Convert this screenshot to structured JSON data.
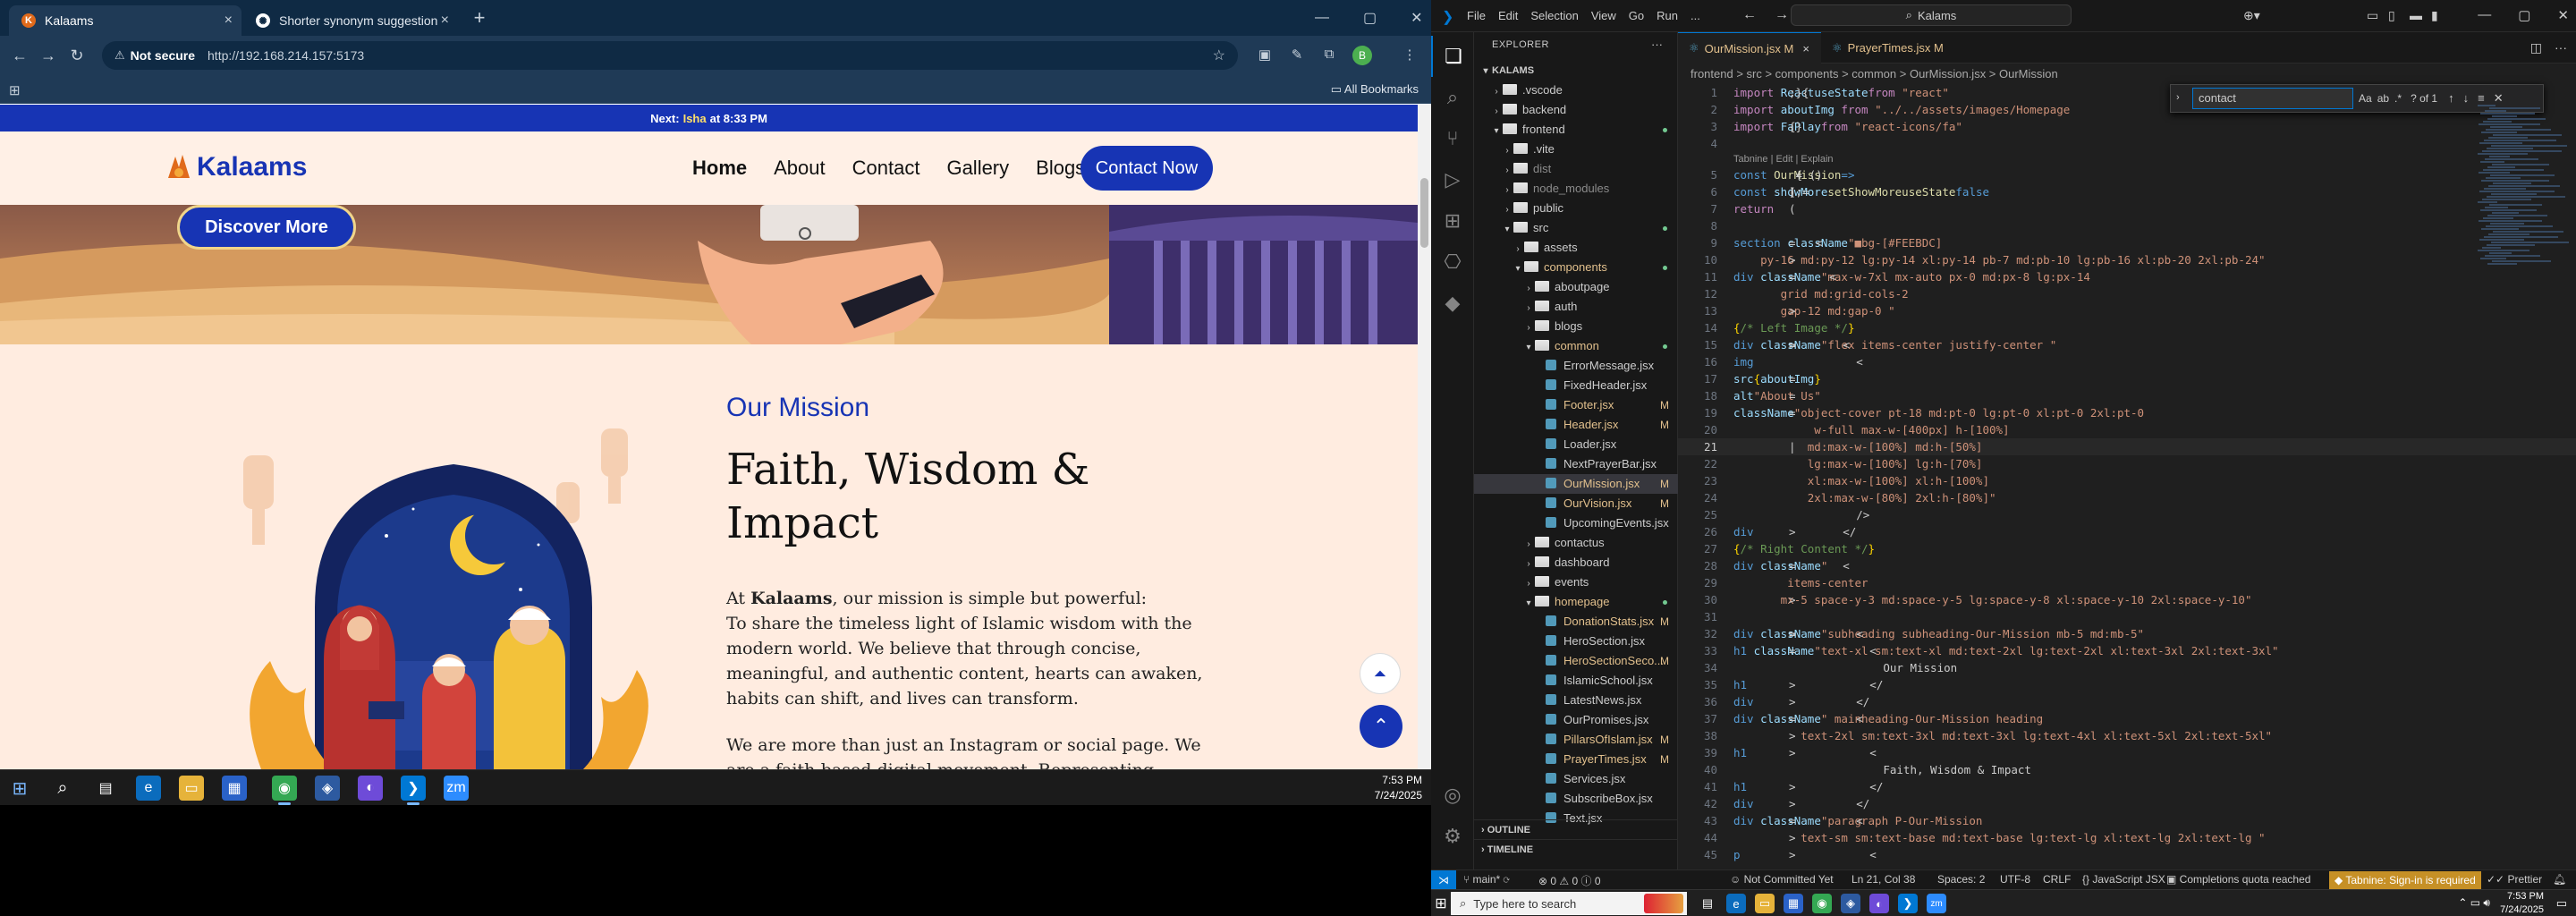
{
  "browser": {
    "tabs": [
      {
        "title": "Kalaams",
        "active": true
      },
      {
        "title": "Shorter synonym suggestion",
        "active": false
      }
    ],
    "security_label": "Not secure",
    "url": "http://192.168.214.157:5173",
    "all_bookmarks": "All Bookmarks",
    "profile_initial": "B"
  },
  "site": {
    "top_strip_prefix": "Next:",
    "top_strip_name": "Isha",
    "top_strip_suffix": "at 8:33 PM",
    "logo_text": "Kalaams",
    "nav": [
      "Home",
      "About",
      "Contact",
      "Gallery",
      "Blogs"
    ],
    "cta": "Contact Now",
    "discover": "Discover More",
    "mission": {
      "subheading": "Our Mission",
      "title": "Faith, Wisdom & Impact",
      "para1_prefix": "At",
      "para1_brand": "Kalaams",
      "para1_rest": ", our mission is simple but powerful:",
      "para1_body": "To share the timeless light of Islamic wisdom with the modern world. We believe that through concise, meaningful, and authentic content, hearts can awaken, habits can shift, and lives can transform.",
      "para2": "We are more than just an Instagram or social page. We are a faith-based digital movement. Representing Kalaams official"
    }
  },
  "taskbar1": {
    "time": "7:53 PM",
    "date": "7/24/2025"
  },
  "vscode": {
    "menu": [
      "File",
      "Edit",
      "Selection",
      "View",
      "Go",
      "Run",
      "..."
    ],
    "search": "Kalams",
    "explorer_label": "EXPLORER",
    "root": "KALAMS",
    "tree": [
      {
        "name": ".vscode",
        "depth": 1,
        "type": "folder",
        "open": false
      },
      {
        "name": "backend",
        "depth": 1,
        "type": "folder",
        "open": false
      },
      {
        "name": "frontend",
        "depth": 1,
        "type": "folder",
        "open": true,
        "mod": "dot"
      },
      {
        "name": ".vite",
        "depth": 2,
        "type": "folder",
        "open": false
      },
      {
        "name": "dist",
        "depth": 2,
        "type": "folder",
        "open": false,
        "dim": true
      },
      {
        "name": "node_modules",
        "depth": 2,
        "type": "folder",
        "open": false,
        "dim": true
      },
      {
        "name": "public",
        "depth": 2,
        "type": "folder",
        "open": false
      },
      {
        "name": "src",
        "depth": 2,
        "type": "folder",
        "open": true,
        "mod": "dot"
      },
      {
        "name": "assets",
        "depth": 3,
        "type": "folder",
        "open": false
      },
      {
        "name": "components",
        "depth": 3,
        "type": "folder",
        "open": true,
        "mod": "dot",
        "modc": true
      },
      {
        "name": "aboutpage",
        "depth": 4,
        "type": "folder",
        "open": false
      },
      {
        "name": "auth",
        "depth": 4,
        "type": "folder",
        "open": false
      },
      {
        "name": "blogs",
        "depth": 4,
        "type": "folder",
        "open": false
      },
      {
        "name": "common",
        "depth": 4,
        "type": "folder",
        "open": true,
        "mod": "dot",
        "modc": true
      },
      {
        "name": "ErrorMessage.jsx",
        "depth": 5,
        "type": "file"
      },
      {
        "name": "FixedHeader.jsx",
        "depth": 5,
        "type": "file"
      },
      {
        "name": "Footer.jsx",
        "depth": 5,
        "type": "file",
        "mod": "M"
      },
      {
        "name": "Header.jsx",
        "depth": 5,
        "type": "file",
        "mod": "M"
      },
      {
        "name": "Loader.jsx",
        "depth": 5,
        "type": "file"
      },
      {
        "name": "NextPrayerBar.jsx",
        "depth": 5,
        "type": "file"
      },
      {
        "name": "OurMission.jsx",
        "depth": 5,
        "type": "file",
        "mod": "M",
        "sel": true
      },
      {
        "name": "OurVision.jsx",
        "depth": 5,
        "type": "file",
        "mod": "M"
      },
      {
        "name": "UpcomingEvents.jsx",
        "depth": 5,
        "type": "file"
      },
      {
        "name": "contactus",
        "depth": 4,
        "type": "folder",
        "open": false
      },
      {
        "name": "dashboard",
        "depth": 4,
        "type": "folder",
        "open": false
      },
      {
        "name": "events",
        "depth": 4,
        "type": "folder",
        "open": false
      },
      {
        "name": "homepage",
        "depth": 4,
        "type": "folder",
        "open": true,
        "mod": "dot",
        "modc": true
      },
      {
        "name": "DonationStats.jsx",
        "depth": 5,
        "type": "file",
        "mod": "M"
      },
      {
        "name": "HeroSection.jsx",
        "depth": 5,
        "type": "file"
      },
      {
        "name": "HeroSectionSeco...",
        "depth": 5,
        "type": "file",
        "mod": "M"
      },
      {
        "name": "IslamicSchool.jsx",
        "depth": 5,
        "type": "file"
      },
      {
        "name": "LatestNews.jsx",
        "depth": 5,
        "type": "file"
      },
      {
        "name": "OurPromises.jsx",
        "depth": 5,
        "type": "file"
      },
      {
        "name": "PillarsOfIslam.jsx",
        "depth": 5,
        "type": "file",
        "mod": "M"
      },
      {
        "name": "PrayerTimes.jsx",
        "depth": 5,
        "type": "file",
        "mod": "M"
      },
      {
        "name": "Services.jsx",
        "depth": 5,
        "type": "file"
      },
      {
        "name": "SubscribeBox.jsx",
        "depth": 5,
        "type": "file"
      },
      {
        "name": "Text.jsx",
        "depth": 5,
        "type": "file"
      }
    ],
    "outline": "OUTLINE",
    "timeline": "TIMELINE",
    "editor_tabs": [
      {
        "name": "OurMission.jsx",
        "mod": "M",
        "active": true
      },
      {
        "name": "PrayerTimes.jsx",
        "mod": "M",
        "active": false
      }
    ],
    "breadcrumb": "frontend > src > components > common > OurMission.jsx > OurMission",
    "find": {
      "query": "contact",
      "result": "? of 1"
    },
    "lens": "Tabnine | Edit | Explain",
    "status": {
      "branch": "main*",
      "errors": "0",
      "warnings": "0",
      "problems_extra": "0",
      "commit": "Not Committed Yet",
      "position": "Ln 21, Col 38",
      "spaces": "Spaces: 2",
      "encoding": "UTF-8",
      "eol": "CRLF",
      "language": "JavaScript JSX",
      "quota": "Completions quota reached",
      "tabnine": "Tabnine: Sign-in is required",
      "prettier": "Prettier"
    }
  },
  "code": [
    [
      [
        "kw",
        "import "
      ],
      [
        "vr",
        "React"
      ],
      [
        "tx",
        ", { "
      ],
      [
        "vr",
        "useState"
      ],
      [
        "tx",
        " } "
      ],
      [
        "kw",
        "from "
      ],
      [
        "st",
        "\"react\""
      ],
      [
        "tx",
        ";"
      ]
    ],
    [
      [
        "kw",
        "import "
      ],
      [
        "vr",
        "aboutImg"
      ],
      [
        "kw",
        " from "
      ],
      [
        "st",
        "\"../../assets/images/Homepage"
      ]
    ],
    [
      [
        "kw",
        "import "
      ],
      [
        "tx",
        "{ "
      ],
      [
        "vr",
        "FaPlay"
      ],
      [
        "tx",
        " } "
      ],
      [
        "kw",
        "from "
      ],
      [
        "st",
        "\"react-icons/fa\""
      ],
      [
        "tx",
        ";"
      ]
    ],
    [],
    [
      [
        "kb",
        "const "
      ],
      [
        "fn",
        "OurMission"
      ],
      [
        "tx",
        " = () "
      ],
      [
        "kb",
        "=>"
      ],
      [
        "tx",
        " {"
      ]
    ],
    [
      [
        "tx",
        "  "
      ],
      [
        "kb",
        "const "
      ],
      [
        "tx",
        "["
      ],
      [
        "vr",
        "showMore"
      ],
      [
        "tx",
        ", "
      ],
      [
        "fn",
        "setShowMore"
      ],
      [
        "tx",
        "] = "
      ],
      [
        "fn",
        "useState"
      ],
      [
        "tx",
        "("
      ],
      [
        "kb",
        "false"
      ],
      [
        "tx",
        ");"
      ]
    ],
    [
      [
        "tx",
        "  "
      ],
      [
        "kw",
        "return "
      ],
      [
        "tx",
        "("
      ]
    ],
    [],
    [
      [
        "tx",
        "    <"
      ],
      [
        "tg",
        "section "
      ],
      [
        "at",
        "className"
      ],
      [
        "tx",
        "="
      ],
      [
        "st",
        "\"■bg-[#FEEBDC]"
      ]
    ],
    [
      [
        "st",
        "    py-16 md:py-12 lg:py-14 xl:py-14 pb-7 md:pb-10 lg:pb-16 xl:pb-20 2xl:pb-24\""
      ],
      [
        "tx",
        ">"
      ]
    ],
    [
      [
        "tx",
        "      <"
      ],
      [
        "tg",
        "div "
      ],
      [
        "at",
        "className"
      ],
      [
        "tx",
        "="
      ],
      [
        "st",
        "\"max-w-7xl mx-auto px-0 md:px-8 lg:px-14"
      ]
    ],
    [
      [
        "st",
        "       grid md:grid-cols-2"
      ]
    ],
    [
      [
        "st",
        "       gap-12 md:gap-0 \""
      ],
      [
        "tx",
        ">"
      ]
    ],
    [
      [
        "tx",
        "        "
      ],
      [
        "pu",
        "{"
      ],
      [
        "cm",
        "/* Left Image */"
      ],
      [
        "pu",
        "}"
      ]
    ],
    [
      [
        "tx",
        "        <"
      ],
      [
        "tg",
        "div "
      ],
      [
        "at",
        "className"
      ],
      [
        "tx",
        "="
      ],
      [
        "st",
        "\"flex items-center justify-center \""
      ],
      [
        "tx",
        ">"
      ]
    ],
    [
      [
        "tx",
        "          <"
      ],
      [
        "tg",
        "img"
      ]
    ],
    [
      [
        "tx",
        "            "
      ],
      [
        "at",
        "src"
      ],
      [
        "tx",
        "="
      ],
      [
        "pu",
        "{"
      ],
      [
        "vr",
        "aboutImg"
      ],
      [
        "pu",
        "}"
      ]
    ],
    [
      [
        "tx",
        "            "
      ],
      [
        "at",
        "alt"
      ],
      [
        "tx",
        "="
      ],
      [
        "st",
        "\"About Us\""
      ]
    ],
    [
      [
        "tx",
        "            "
      ],
      [
        "at",
        "className"
      ],
      [
        "tx",
        "="
      ],
      [
        "st",
        "\"object-cover pt-18 md:pt-0 lg:pt-0 xl:pt-0 2xl:pt-0"
      ]
    ],
    [
      [
        "st",
        "            w-full max-w-[400px] h-[100%]"
      ]
    ],
    [
      [
        "st",
        "           md:max-w-[100%] md:h-[50%]"
      ],
      [
        "tx",
        "|"
      ]
    ],
    [
      [
        "st",
        "           lg:max-w-[100%] lg:h-[70%]"
      ]
    ],
    [
      [
        "st",
        "           xl:max-w-[100%] xl:h-[100%]"
      ]
    ],
    [
      [
        "st",
        "           2xl:max-w-[80%] 2xl:h-[80%]\""
      ]
    ],
    [
      [
        "tx",
        "          />"
      ]
    ],
    [
      [
        "tx",
        "        </"
      ],
      [
        "tg",
        "div"
      ],
      [
        "tx",
        ">"
      ]
    ],
    [
      [
        "tx",
        "        "
      ],
      [
        "pu",
        "{"
      ],
      [
        "cm",
        "/* Right Content */"
      ],
      [
        "pu",
        "}"
      ]
    ],
    [
      [
        "tx",
        "        <"
      ],
      [
        "tg",
        "div "
      ],
      [
        "at",
        "className"
      ],
      [
        "tx",
        "="
      ],
      [
        "st",
        "\""
      ]
    ],
    [
      [
        "st",
        "        items-center"
      ]
    ],
    [
      [
        "st",
        "       mx-5 space-y-3 md:space-y-5 lg:space-y-8 xl:space-y-10 2xl:space-y-10\""
      ],
      [
        "tx",
        ">"
      ]
    ],
    [],
    [
      [
        "tx",
        "          <"
      ],
      [
        "tg",
        "div "
      ],
      [
        "at",
        "className"
      ],
      [
        "tx",
        "="
      ],
      [
        "st",
        "\"subheading subheading-Our-Mission mb-5 md:mb-5\""
      ],
      [
        "tx",
        ">"
      ]
    ],
    [
      [
        "tx",
        "            <"
      ],
      [
        "tg",
        "h1 "
      ],
      [
        "at",
        "className"
      ],
      [
        "tx",
        "="
      ],
      [
        "st",
        "\"text-xl sm:text-xl md:text-2xl lg:text-2xl xl:text-3xl 2xl:text-3xl\""
      ]
    ],
    [
      [
        "tx",
        "              Our Mission"
      ]
    ],
    [
      [
        "tx",
        "            </"
      ],
      [
        "tg",
        "h1"
      ],
      [
        "tx",
        ">"
      ]
    ],
    [
      [
        "tx",
        "          </"
      ],
      [
        "tg",
        "div"
      ],
      [
        "tx",
        ">"
      ]
    ],
    [
      [
        "tx",
        "          <"
      ],
      [
        "tg",
        "div "
      ],
      [
        "at",
        "className"
      ],
      [
        "tx",
        "="
      ],
      [
        "st",
        "\" mainheading-Our-Mission heading"
      ]
    ],
    [
      [
        "st",
        "          text-2xl sm:text-3xl md:text-3xl lg:text-4xl xl:text-5xl 2xl:text-5xl\""
      ],
      [
        "tx",
        ">"
      ]
    ],
    [
      [
        "tx",
        "            <"
      ],
      [
        "tg",
        "h1"
      ],
      [
        "tx",
        ">"
      ]
    ],
    [
      [
        "tx",
        "              Faith, Wisdom & Impact"
      ]
    ],
    [
      [
        "tx",
        "            </"
      ],
      [
        "tg",
        "h1"
      ],
      [
        "tx",
        ">"
      ]
    ],
    [
      [
        "tx",
        "          </"
      ],
      [
        "tg",
        "div"
      ],
      [
        "tx",
        ">"
      ]
    ],
    [
      [
        "tx",
        "          <"
      ],
      [
        "tg",
        "div "
      ],
      [
        "at",
        "className"
      ],
      [
        "tx",
        "="
      ],
      [
        "st",
        "\"paragraph P-Our-Mission"
      ]
    ],
    [
      [
        "st",
        "          text-sm sm:text-base md:text-base lg:text-lg xl:text-lg 2xl:text-lg \""
      ],
      [
        "tx",
        ">"
      ]
    ],
    [
      [
        "tx",
        "            <"
      ],
      [
        "tg",
        "p"
      ],
      [
        "tx",
        ">"
      ]
    ]
  ],
  "taskbar2": {
    "search_placeholder": "Type here to search",
    "time": "7:53 PM",
    "date": "7/24/2025"
  }
}
